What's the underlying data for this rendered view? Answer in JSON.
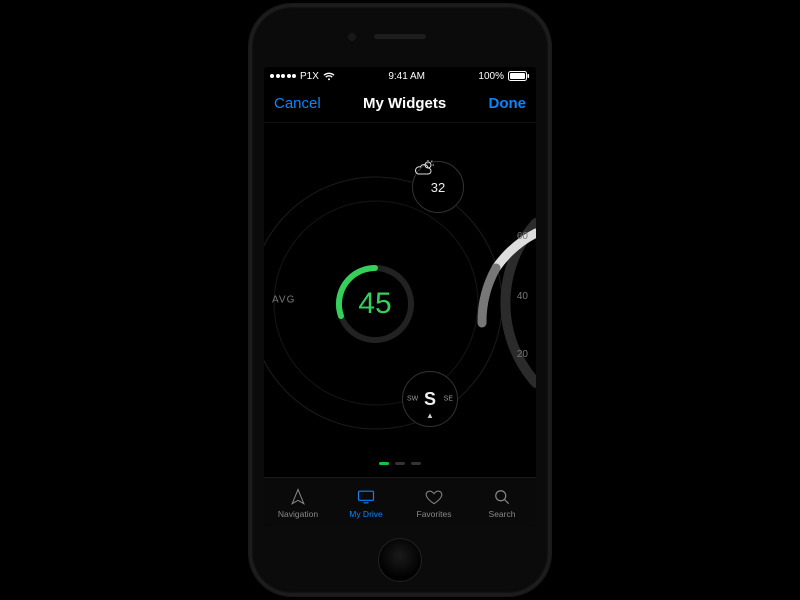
{
  "statusbar": {
    "carrier": "P1X",
    "time": "9:41 AM",
    "battery_pct": "100%"
  },
  "navbar": {
    "cancel": "Cancel",
    "title": "My Widgets",
    "done": "Done"
  },
  "avg_label": "AVG",
  "speed": {
    "value": "45"
  },
  "weather": {
    "temp": "32"
  },
  "compass": {
    "cardinal": "S",
    "sw": "SW",
    "se": "SE"
  },
  "gauge_ticks": {
    "t60": "60",
    "t40": "40",
    "t20": "20"
  },
  "page_index": 0,
  "page_count": 3,
  "tabs": [
    {
      "label": "Navigation"
    },
    {
      "label": "My Drive"
    },
    {
      "label": "Favorites"
    },
    {
      "label": "Search"
    }
  ],
  "active_tab": 1,
  "colors": {
    "accent": "#0a84ff",
    "speed": "#35d05a"
  }
}
